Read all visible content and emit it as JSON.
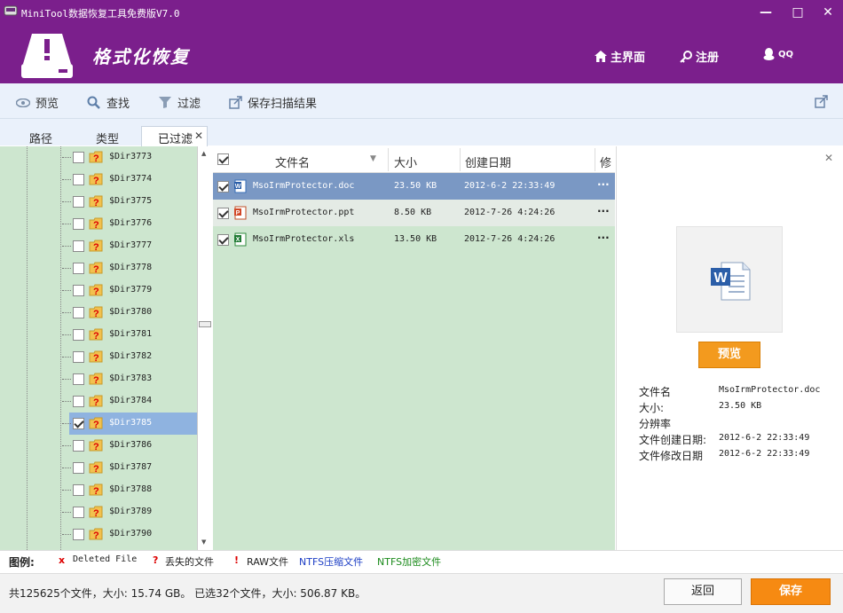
{
  "window": {
    "title": "MiniTool数据恢复工具免费版V7.0",
    "minimize": "—",
    "maximize": "□",
    "close": "✕"
  },
  "header": {
    "title": "格式化恢复",
    "nav": [
      {
        "label": "主界面"
      },
      {
        "label": "注册"
      },
      {
        "label": "QQ"
      }
    ]
  },
  "toolbar": {
    "preview": "预览",
    "find": "查找",
    "filter": "过滤",
    "save_scan": "保存扫描结果"
  },
  "tabs": {
    "path": "路径",
    "type": "类型",
    "filtered": "已过滤"
  },
  "tree": {
    "items": [
      {
        "name": "$Dir3773",
        "checked": false
      },
      {
        "name": "$Dir3774",
        "checked": false
      },
      {
        "name": "$Dir3775",
        "checked": false
      },
      {
        "name": "$Dir3776",
        "checked": false
      },
      {
        "name": "$Dir3777",
        "checked": false
      },
      {
        "name": "$Dir3778",
        "checked": false
      },
      {
        "name": "$Dir3779",
        "checked": false
      },
      {
        "name": "$Dir3780",
        "checked": false
      },
      {
        "name": "$Dir3781",
        "checked": false
      },
      {
        "name": "$Dir3782",
        "checked": false
      },
      {
        "name": "$Dir3783",
        "checked": false
      },
      {
        "name": "$Dir3784",
        "checked": false
      },
      {
        "name": "$Dir3785",
        "checked": true,
        "selected": true
      },
      {
        "name": "$Dir3786",
        "checked": false
      },
      {
        "name": "$Dir3787",
        "checked": false
      },
      {
        "name": "$Dir3788",
        "checked": false
      },
      {
        "name": "$Dir3789",
        "checked": false
      },
      {
        "name": "$Dir3790",
        "checked": false
      }
    ]
  },
  "list": {
    "columns": {
      "name": "文件名",
      "size": "大小",
      "created": "创建日期",
      "modified": "修"
    },
    "rows": [
      {
        "name": "MsoIrmProtector.doc",
        "size": "23.50 KB",
        "created": "2012-6-2 22:33:49",
        "more": "···",
        "type": "doc",
        "selected": true
      },
      {
        "name": "MsoIrmProtector.ppt",
        "size": "8.50 KB",
        "created": "2012-7-26 4:24:26",
        "more": "···",
        "type": "ppt"
      },
      {
        "name": "MsoIrmProtector.xls",
        "size": "13.50 KB",
        "created": "2012-7-26 4:24:26",
        "more": "···",
        "type": "xls"
      }
    ]
  },
  "preview": {
    "button": "预览",
    "close": "✕",
    "fields": [
      {
        "label": "文件名",
        "value": "MsoIrmProtector.doc"
      },
      {
        "label": "大小:",
        "value": "23.50 KB"
      },
      {
        "label": "分辨率",
        "value": ""
      },
      {
        "label": "文件创建日期:",
        "value": "2012-6-2 22:33:49"
      },
      {
        "label": "文件修改日期",
        "value": "2012-6-2 22:33:49"
      }
    ]
  },
  "legend": {
    "title": "图例:",
    "deleted_mark": "x",
    "deleted": "Deleted File",
    "lost_mark": "?",
    "lost": "丢失的文件",
    "raw_mark": "!",
    "raw": "RAW文件",
    "ntfs_comp": "NTFS压缩文件",
    "ntfs_enc": "NTFS加密文件"
  },
  "status": {
    "text": "共125625个文件，大小: 15.74 GB。 已选32个文件，大小: 506.87 KB。"
  },
  "buttons": {
    "back": "返回",
    "save": "保存"
  },
  "colors": {
    "accent": "#7b1f8c",
    "tree_bg": "#cde6cf",
    "selected": "#8fb3e0",
    "save": "#f68a12"
  }
}
